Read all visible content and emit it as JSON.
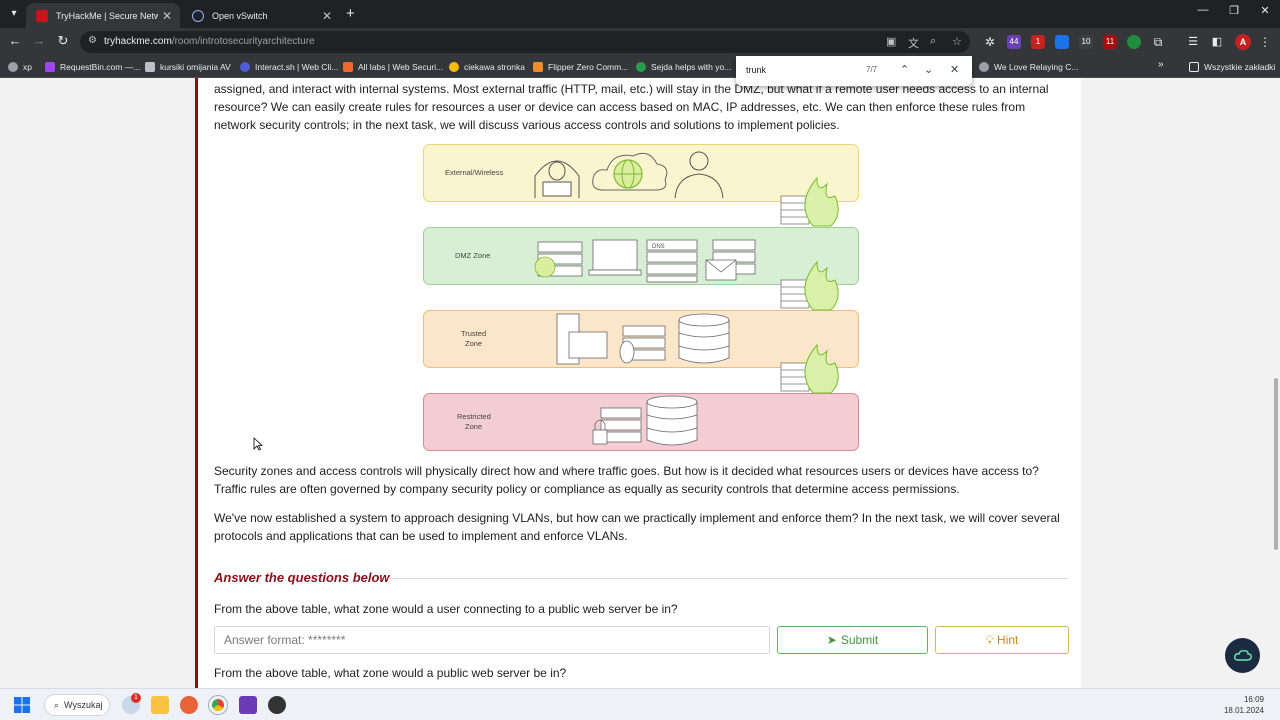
{
  "browser": {
    "tabs": [
      {
        "title": "TryHackMe | Secure Network A",
        "active": true
      },
      {
        "title": "Open vSwitch",
        "active": false
      }
    ],
    "url_domain": "tryhackme.com",
    "url_path": "/room/introtosecurityarchitecture",
    "bookmarks": [
      "xp",
      "RequestBin.com —...",
      "kursiki omijania AV",
      "Interact.sh | Web Cli...",
      "All labs | Web Securi...",
      "ciekawa stronka",
      "Flipper Zero Comm...",
      "Sejda helps with yo...",
      "We Love Relaying C..."
    ],
    "bookmarks_folder": "Wszystkie zakładki",
    "find": {
      "query": "trunk",
      "count": "7/7"
    },
    "extension_badges": [
      "44",
      "1",
      "10",
      "11"
    ],
    "profile_initial": "A"
  },
  "content": {
    "para_top": "assigned, and interact with internal systems. Most external traffic (HTTP, mail, etc.) will stay in the DMZ, but what if a remote user needs access to an internal resource? We can easily create rules for resources a user or device can access based on MAC, IP addresses, etc. We can then enforce these rules from network security controls; in the next task, we will discuss various access controls and solutions to implement policies.",
    "para_zones": "Security zones and access controls will physically direct how and where traffic goes. But how is it decided what resources users or devices have access to? Traffic rules are often governed by company security policy or compliance as equally as security controls that determine access permissions.",
    "para_vlans": "We've now established a system to approach designing VLANs, but how can we practically implement and enforce them? In the next task, we will cover several protocols and applications that can be used to implement and enforce VLANs.",
    "section_title": "Answer the questions below",
    "question1": "From the above table, what zone would a user connecting to a public web server be in?",
    "answer_placeholder": "Answer format: ********",
    "submit_label": "Submit",
    "hint_label": "Hint",
    "question2": "From the above table, what zone would a public web server be in?"
  },
  "diagram": {
    "zones": [
      {
        "label_line1": "External/Wireless",
        "label_line2": "",
        "fill": "#fbf5cf",
        "border": "#e6d878"
      },
      {
        "label_line1": "DMZ Zone",
        "label_line2": "",
        "fill": "#d8efd6",
        "border": "#9ccf96"
      },
      {
        "label_line1": "Trusted",
        "label_line2": "Zone",
        "fill": "#fbe6c9",
        "border": "#e8c07c"
      },
      {
        "label_line1": "Restricted",
        "label_line2": "Zone",
        "fill": "#f4ccd3",
        "border": "#d98a98"
      }
    ],
    "dns_label": "DNS"
  },
  "taskbar": {
    "search_label": "Wyszukaj",
    "time": "16:09",
    "date": "18.01.2024",
    "notification_badge": "1"
  },
  "colors": {
    "accent": "#8b0f19",
    "submit": "#3c9a3c",
    "hint": "#c98a20"
  }
}
